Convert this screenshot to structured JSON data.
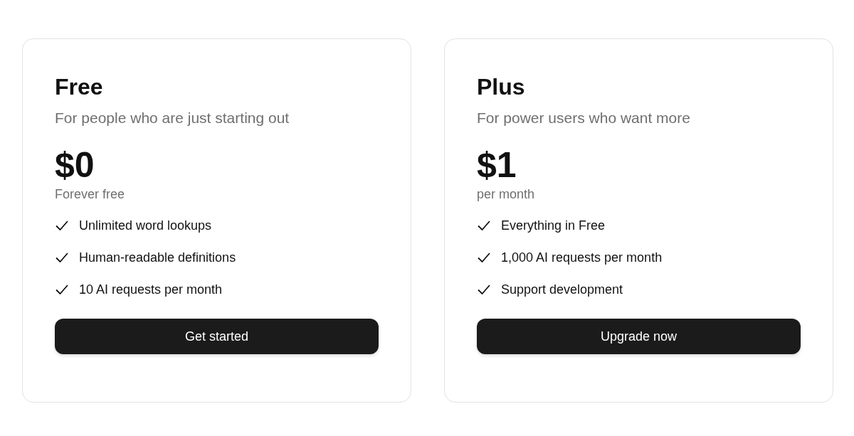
{
  "plans": [
    {
      "name": "Free",
      "description": "For people who are just starting out",
      "price": "$0",
      "period": "Forever free",
      "features": [
        "Unlimited word lookups",
        "Human-readable definitions",
        "10 AI requests per month"
      ],
      "button": "Get started"
    },
    {
      "name": "Plus",
      "description": "For power users who want more",
      "price": "$1",
      "period": "per month",
      "features": [
        "Everything in Free",
        "1,000 AI requests per month",
        "Support development"
      ],
      "button": "Upgrade now"
    }
  ]
}
